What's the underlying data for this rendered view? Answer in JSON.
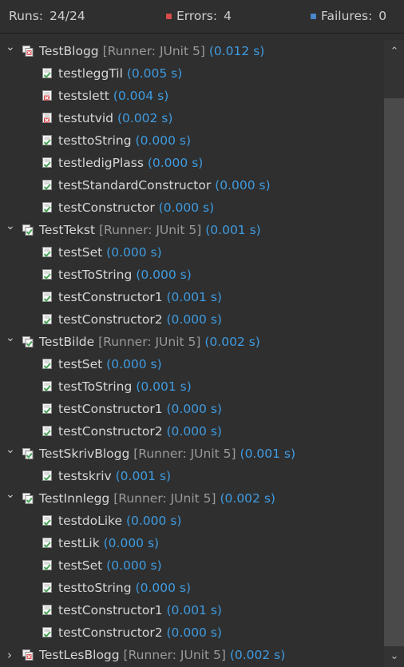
{
  "status": {
    "runs_label": "Runs:",
    "runs_value": "24/24",
    "errors_label": "Errors:",
    "errors_value": "4",
    "failures_label": "Failures:",
    "failures_value": "0"
  },
  "colors": {
    "time": "#3f9be0",
    "runner": "#9a9a9a",
    "pass": "#4aa35a",
    "error": "#d94a4a"
  },
  "suites": [
    {
      "name": "TestBlogg",
      "runner": "[Runner: JUnit 5]",
      "time": "(0.012 s)",
      "expanded": true,
      "status": "error",
      "tests": [
        {
          "name": "testleggTil",
          "time": "(0.005 s)",
          "status": "pass"
        },
        {
          "name": "testslett",
          "time": "(0.004 s)",
          "status": "error"
        },
        {
          "name": "testutvid",
          "time": "(0.002 s)",
          "status": "error"
        },
        {
          "name": "testtoString",
          "time": "(0.000 s)",
          "status": "pass"
        },
        {
          "name": "testledigPlass",
          "time": "(0.000 s)",
          "status": "pass"
        },
        {
          "name": "testStandardConstructor",
          "time": "(0.000 s)",
          "status": "pass"
        },
        {
          "name": "testConstructor",
          "time": "(0.000 s)",
          "status": "pass"
        }
      ]
    },
    {
      "name": "TestTekst",
      "runner": "[Runner: JUnit 5]",
      "time": "(0.001 s)",
      "expanded": true,
      "status": "pass",
      "tests": [
        {
          "name": "testSet",
          "time": "(0.000 s)",
          "status": "pass"
        },
        {
          "name": "testToString",
          "time": "(0.000 s)",
          "status": "pass"
        },
        {
          "name": "testConstructor1",
          "time": "(0.001 s)",
          "status": "pass"
        },
        {
          "name": "testConstructor2",
          "time": "(0.000 s)",
          "status": "pass"
        }
      ]
    },
    {
      "name": "TestBilde",
      "runner": "[Runner: JUnit 5]",
      "time": "(0.002 s)",
      "expanded": true,
      "status": "pass",
      "tests": [
        {
          "name": "testSet",
          "time": "(0.000 s)",
          "status": "pass"
        },
        {
          "name": "testToString",
          "time": "(0.001 s)",
          "status": "pass"
        },
        {
          "name": "testConstructor1",
          "time": "(0.000 s)",
          "status": "pass"
        },
        {
          "name": "testConstructor2",
          "time": "(0.000 s)",
          "status": "pass"
        }
      ]
    },
    {
      "name": "TestSkrivBlogg",
      "runner": "[Runner: JUnit 5]",
      "time": "(0.001 s)",
      "expanded": true,
      "status": "pass",
      "tests": [
        {
          "name": "testskriv",
          "time": "(0.001 s)",
          "status": "pass"
        }
      ]
    },
    {
      "name": "TestInnlegg",
      "runner": "[Runner: JUnit 5]",
      "time": "(0.002 s)",
      "expanded": true,
      "status": "pass",
      "tests": [
        {
          "name": "testdoLike",
          "time": "(0.000 s)",
          "status": "pass"
        },
        {
          "name": "testLik",
          "time": "(0.000 s)",
          "status": "pass"
        },
        {
          "name": "testSet",
          "time": "(0.000 s)",
          "status": "pass"
        },
        {
          "name": "testtoString",
          "time": "(0.000 s)",
          "status": "pass"
        },
        {
          "name": "testConstructor1",
          "time": "(0.001 s)",
          "status": "pass"
        },
        {
          "name": "testConstructor2",
          "time": "(0.000 s)",
          "status": "pass"
        }
      ]
    },
    {
      "name": "TestLesBlogg",
      "runner": "[Runner: JUnit 5]",
      "time": "(0.002 s)",
      "expanded": false,
      "status": "error",
      "tests": []
    }
  ]
}
